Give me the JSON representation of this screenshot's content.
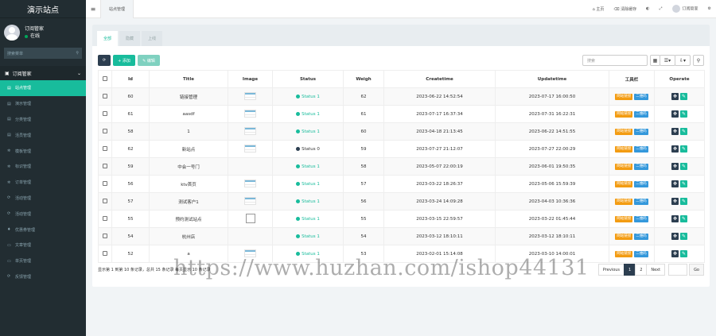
{
  "brand": "演示站点",
  "user": {
    "name": "订阅管家",
    "status": "在线"
  },
  "sidebar": {
    "search_placeholder": "搜索菜单",
    "group": "订阅管家",
    "items": [
      {
        "label": "站点管理",
        "icon": "building-icon",
        "active": true
      },
      {
        "label": "演示管理",
        "icon": "list-icon"
      },
      {
        "label": "分类管理",
        "icon": "list-icon"
      },
      {
        "label": "活员管理",
        "icon": "list-icon"
      },
      {
        "label": "模板管理",
        "icon": "gear-icon"
      },
      {
        "label": "标识管理",
        "icon": "gear-icon"
      },
      {
        "label": "订单管理",
        "icon": "gear-icon"
      },
      {
        "label": "活动管理",
        "icon": "refresh-icon"
      },
      {
        "label": "活动管理",
        "icon": "refresh-icon"
      },
      {
        "label": "优惠券管理",
        "icon": "tag-icon"
      },
      {
        "label": "文章管理",
        "icon": "doc-icon"
      },
      {
        "label": "单页管理",
        "icon": "doc-icon"
      },
      {
        "label": "反馈管理",
        "icon": "refresh-icon"
      }
    ]
  },
  "topbar": {
    "tab": "站点管理",
    "home": "主页",
    "clear_cache": "清除缓存",
    "admin": "订阅管家"
  },
  "tabs": [
    "全部",
    "隐藏",
    "上线"
  ],
  "toolbar": {
    "refresh": "⟳",
    "add": "+ 添加",
    "edit": "✎ 编辑",
    "search_placeholder": "搜索"
  },
  "table": {
    "headers": [
      "Id",
      "Title",
      "Image",
      "Status",
      "Weigh",
      "Createtime",
      "Updatetime",
      "工具栏",
      "Operate"
    ],
    "rows": [
      {
        "id": "60",
        "title": "链接管理",
        "image": "thumb",
        "status": "Status 1",
        "s": 1,
        "weigh": "62",
        "created": "2023-06-22 14:52:54",
        "updated": "2023-07-17 16:00:50"
      },
      {
        "id": "61",
        "title": "aasdf",
        "image": "thumb",
        "status": "Status 1",
        "s": 1,
        "weigh": "61",
        "created": "2023-07-17 16:37:34",
        "updated": "2023-07-31 16:22:31"
      },
      {
        "id": "58",
        "title": "1",
        "image": "thumb",
        "status": "Status 1",
        "s": 1,
        "weigh": "60",
        "created": "2023-04-18 21:13:45",
        "updated": "2023-06-22 14:51:55"
      },
      {
        "id": "62",
        "title": "新站点",
        "image": "thumb",
        "status": "Status 0",
        "s": 0,
        "weigh": "59",
        "created": "2023-07-27 21:12:07",
        "updated": "2023-07-27 22:00:29"
      },
      {
        "id": "59",
        "title": "中会一号门",
        "image": "",
        "status": "Status 1",
        "s": 1,
        "weigh": "58",
        "created": "2023-05-07 22:00:19",
        "updated": "2023-06-01 19:50:35"
      },
      {
        "id": "56",
        "title": "ktv首页",
        "image": "thumb",
        "status": "Status 1",
        "s": 1,
        "weigh": "57",
        "created": "2023-03-22 18:26:37",
        "updated": "2023-05-06 15:59:39"
      },
      {
        "id": "57",
        "title": "测试客户1",
        "image": "thumb",
        "status": "Status 1",
        "s": 1,
        "weigh": "56",
        "created": "2023-03-24 14:09:28",
        "updated": "2023-04-03 10:36:36"
      },
      {
        "id": "55",
        "title": "预约测试站点",
        "image": "broken",
        "status": "Status 1",
        "s": 1,
        "weigh": "55",
        "created": "2023-03-15 22:59:57",
        "updated": "2023-03-22 01:45:44"
      },
      {
        "id": "54",
        "title": "杭州店",
        "image": "",
        "status": "Status 1",
        "s": 1,
        "weigh": "54",
        "created": "2023-03-12 18:10:11",
        "updated": "2023-03-12 18:10:11"
      },
      {
        "id": "52",
        "title": "a",
        "image": "thumb",
        "status": "Status 1",
        "s": 1,
        "weigh": "53",
        "created": "2023-02-01 15:14:08",
        "updated": "2023-03-10 14:00:01"
      }
    ],
    "btn_site": "网站链接",
    "btn_qr": "二维码"
  },
  "footer": {
    "info": "显示第 1 到第 10 条记录，总共 15 条记录 每页显示 10 条记录",
    "prev": "Previous",
    "pages": [
      "1",
      "2"
    ],
    "next": "Next",
    "go": "Go"
  },
  "watermark": "https://www.huzhan.com/ishop44131",
  "colors": {
    "accent": "#18bc9c",
    "sidebar": "#222d32",
    "dark": "#2c3e50",
    "orange": "#f39c12",
    "blue": "#3498db"
  }
}
